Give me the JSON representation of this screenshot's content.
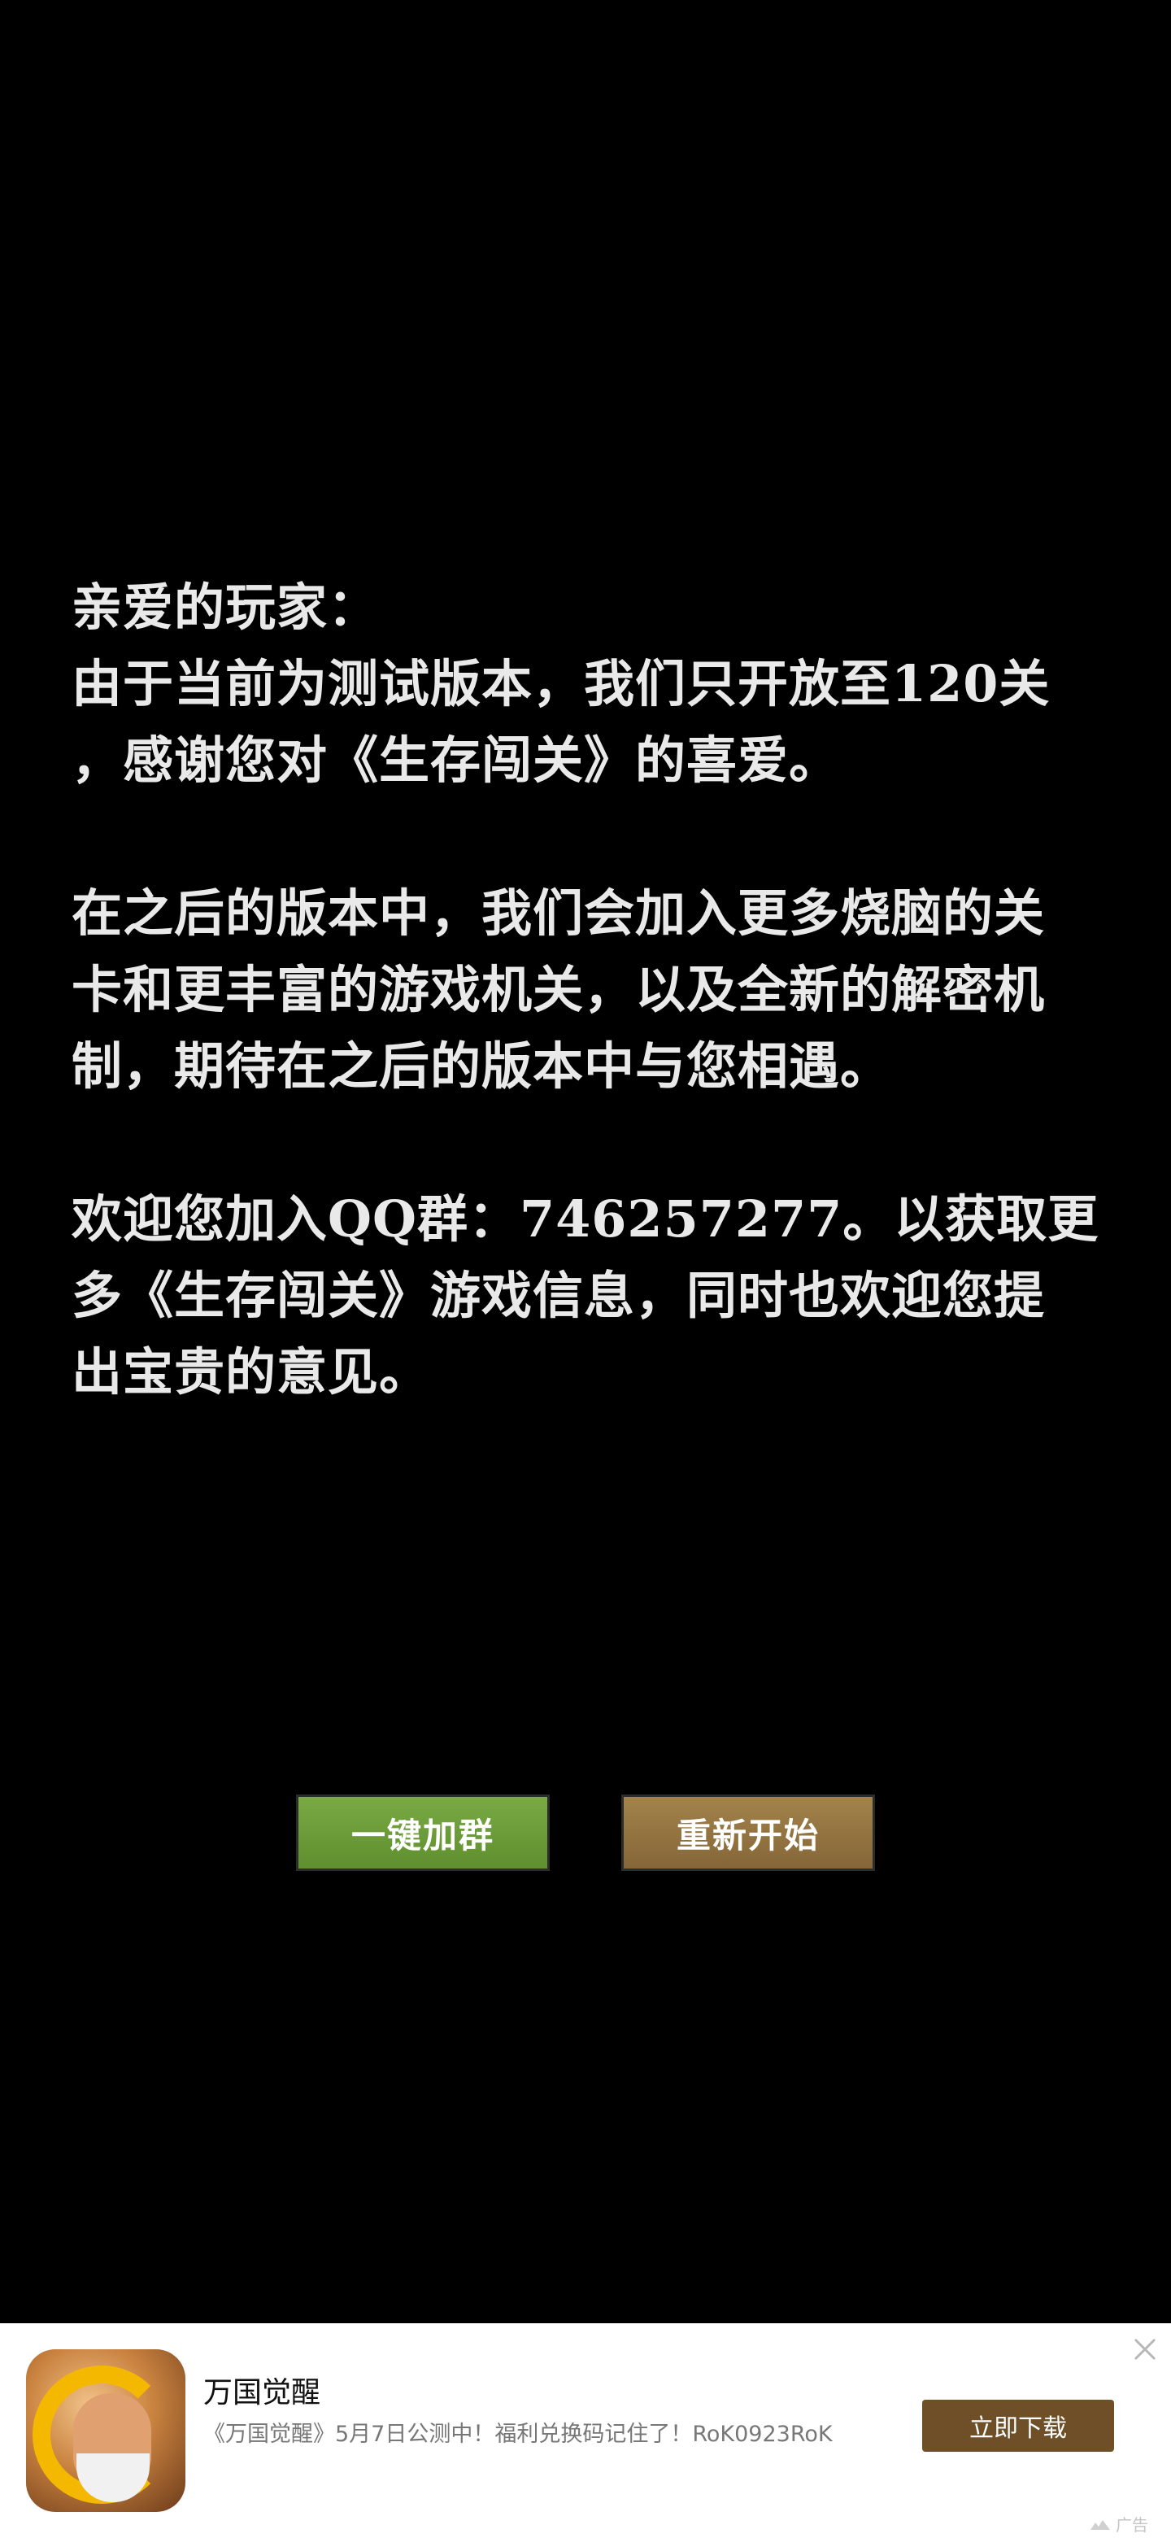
{
  "message": {
    "lines": [
      "亲爱的玩家：",
      "由于当前为测试版本，我们只开放至120关",
      "，感谢您对《生存闯关》的喜爱。",
      "在之后的版本中，我们会加入更多烧脑的关",
      "卡和更丰富的游戏机关，以及全新的解密机",
      "制，期待在之后的版本中与您相遇。",
      "欢迎您加入QQ群：746257277。以获取更",
      "多《生存闯关》游戏信息，同时也欢迎您提",
      "出宝贵的意见。"
    ]
  },
  "buttons": {
    "join_group": "一键加群",
    "restart": "重新开始"
  },
  "ad": {
    "title": "万国觉醒",
    "description": "《万国觉醒》5月7日公测中！福利兑换码记住了！RoK0923RoK",
    "download": "立即下载",
    "label": "广告",
    "logo_icon": "game-logo-icon",
    "close_icon": "close-icon"
  },
  "colors": {
    "background": "#000000",
    "text": "#e9e9e9",
    "join_button": "#6f9d3b",
    "restart_button": "#947544",
    "download_button": "#6e4f28"
  }
}
